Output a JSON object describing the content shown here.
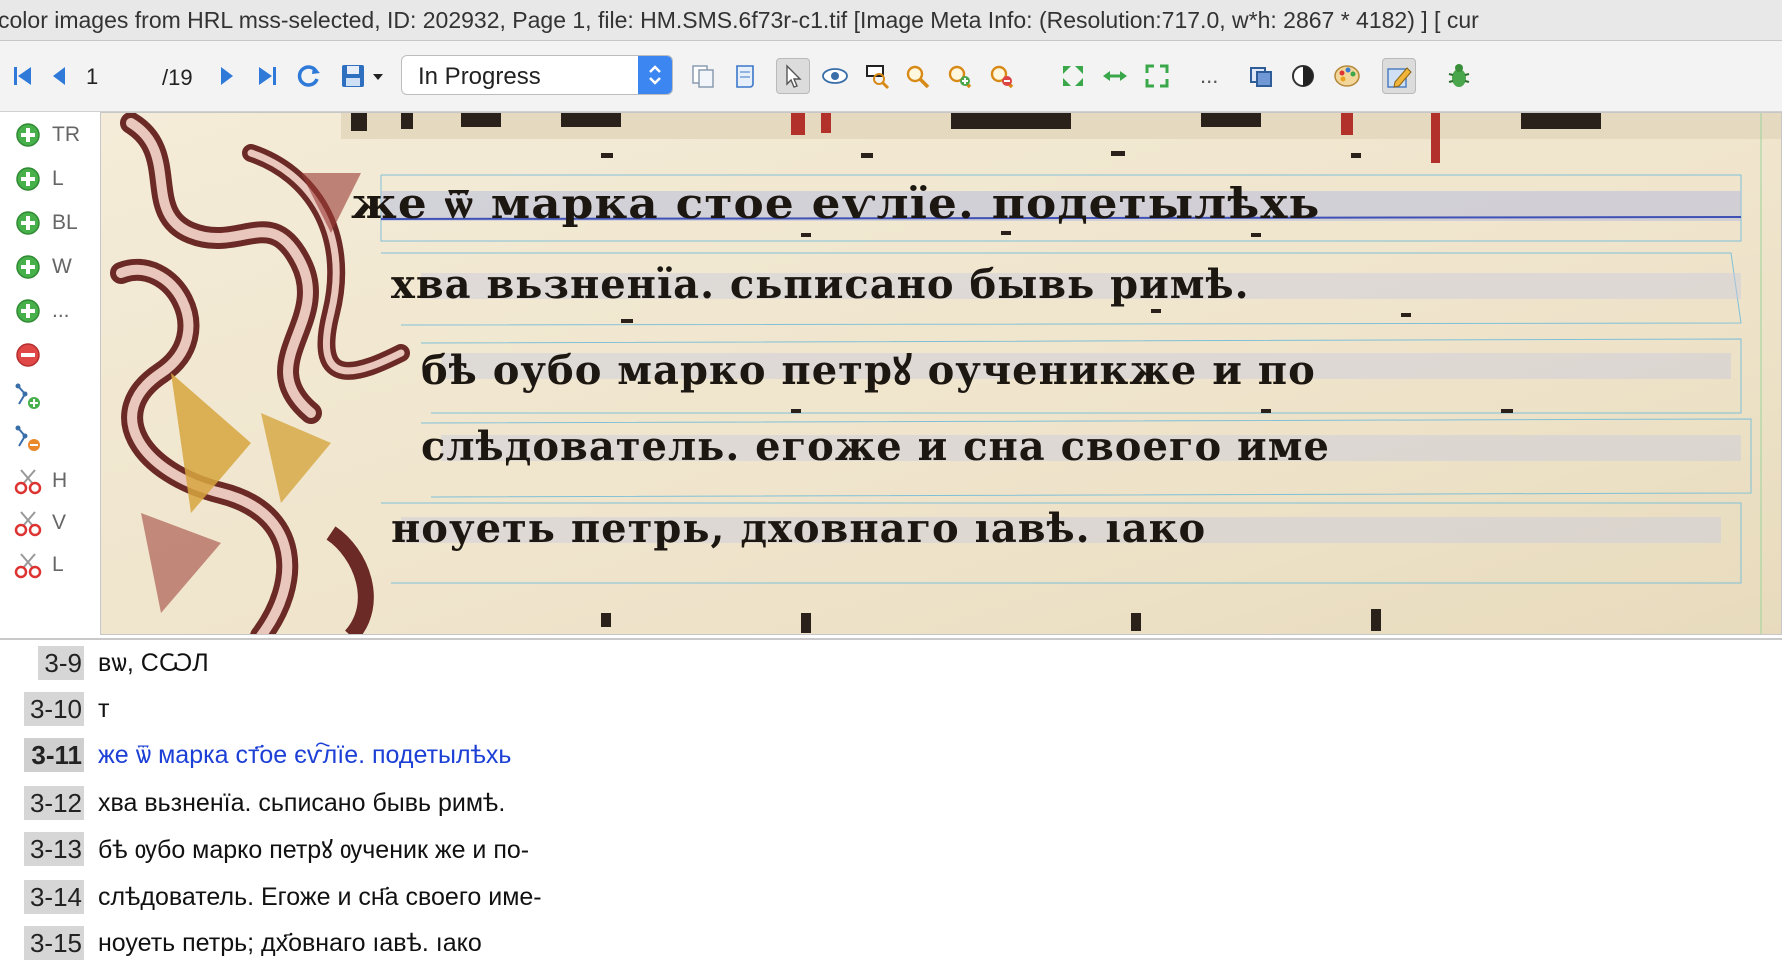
{
  "window": {
    "title": "color images from HRL mss-selected, ID: 202932, Page 1, file: HM.SMS.6f73r-c1.tif [Image Meta Info: (Resolution:717.0, w*h: 2867 * 4182) ] [ cur"
  },
  "toolbar": {
    "page_current": "1",
    "page_total": "/19",
    "status_value": "In Progress",
    "more": "...",
    "icons": [
      "first-page-icon",
      "prev-page-icon",
      "next-page-icon",
      "last-page-icon",
      "refresh-icon",
      "save-icon",
      "save-dropdown-icon",
      "copy-pages-icon",
      "document-icon",
      "pointer-icon",
      "view-icon",
      "zoom-region-icon",
      "zoom-icon",
      "zoom-in-icon",
      "zoom-out-icon",
      "fit-page-icon",
      "fit-width-icon",
      "expand-icon",
      "layers-icon",
      "contrast-icon",
      "palette-icon",
      "edit-icon",
      "bug-icon"
    ]
  },
  "left_tools": [
    {
      "icon": "add-icon",
      "label": "TR"
    },
    {
      "icon": "add-icon",
      "label": "L"
    },
    {
      "icon": "add-icon",
      "label": "BL"
    },
    {
      "icon": "add-icon",
      "label": "W"
    },
    {
      "icon": "add-icon",
      "label": "..."
    },
    {
      "icon": "remove-icon",
      "label": ""
    },
    {
      "icon": "add-point-icon",
      "label": ""
    },
    {
      "icon": "remove-point-icon",
      "label": ""
    },
    {
      "icon": "split-icon",
      "label": "H"
    },
    {
      "icon": "split-icon",
      "label": "V"
    },
    {
      "icon": "split-icon",
      "label": "L"
    }
  ],
  "image": {
    "lines": [
      "же ѿ маркa стoе еѵлїе. подетылѣхь",
      "хва вьзненїа. сьписано бывь римѣ.",
      "бѣ оубо марко петрꙋ оученикже и по",
      "слѣдователь. егоже и сна своего име",
      "ноуеть петрь, дховнаго ıавѣ. ıако"
    ]
  },
  "transcription": {
    "rows": [
      {
        "num": "3-9",
        "text": "вѡ, СѠЛ",
        "current": false
      },
      {
        "num": "3-10",
        "text": "т",
        "current": false
      },
      {
        "num": "3-11",
        "text": "же ѿ марка ст҃ое єѵ҇лїе. подетылѣхь",
        "current": true
      },
      {
        "num": "3-12",
        "text": "хва вьзненїа. сьписано бывь римѣ.",
        "current": false
      },
      {
        "num": "3-13",
        "text": "бѣ ѹбо марко петрꙋ ѹченик же и по-",
        "current": false
      },
      {
        "num": "3-14",
        "text": "слѣдователь. Егоже и сн҃а своего име-",
        "current": false
      },
      {
        "num": "3-15",
        "text": "ноуеть петрь; дх҃овнаго ıавѣ. ıако",
        "current": false
      }
    ]
  },
  "colors": {
    "accent": "#3b86f0",
    "current_line_text": "#1c3fd6",
    "add_green": "#47b04b",
    "remove_red": "#e04848",
    "parchment": "#efe5cf",
    "ornament_red": "#9a3b35",
    "ornament_gold": "#d7a640"
  }
}
